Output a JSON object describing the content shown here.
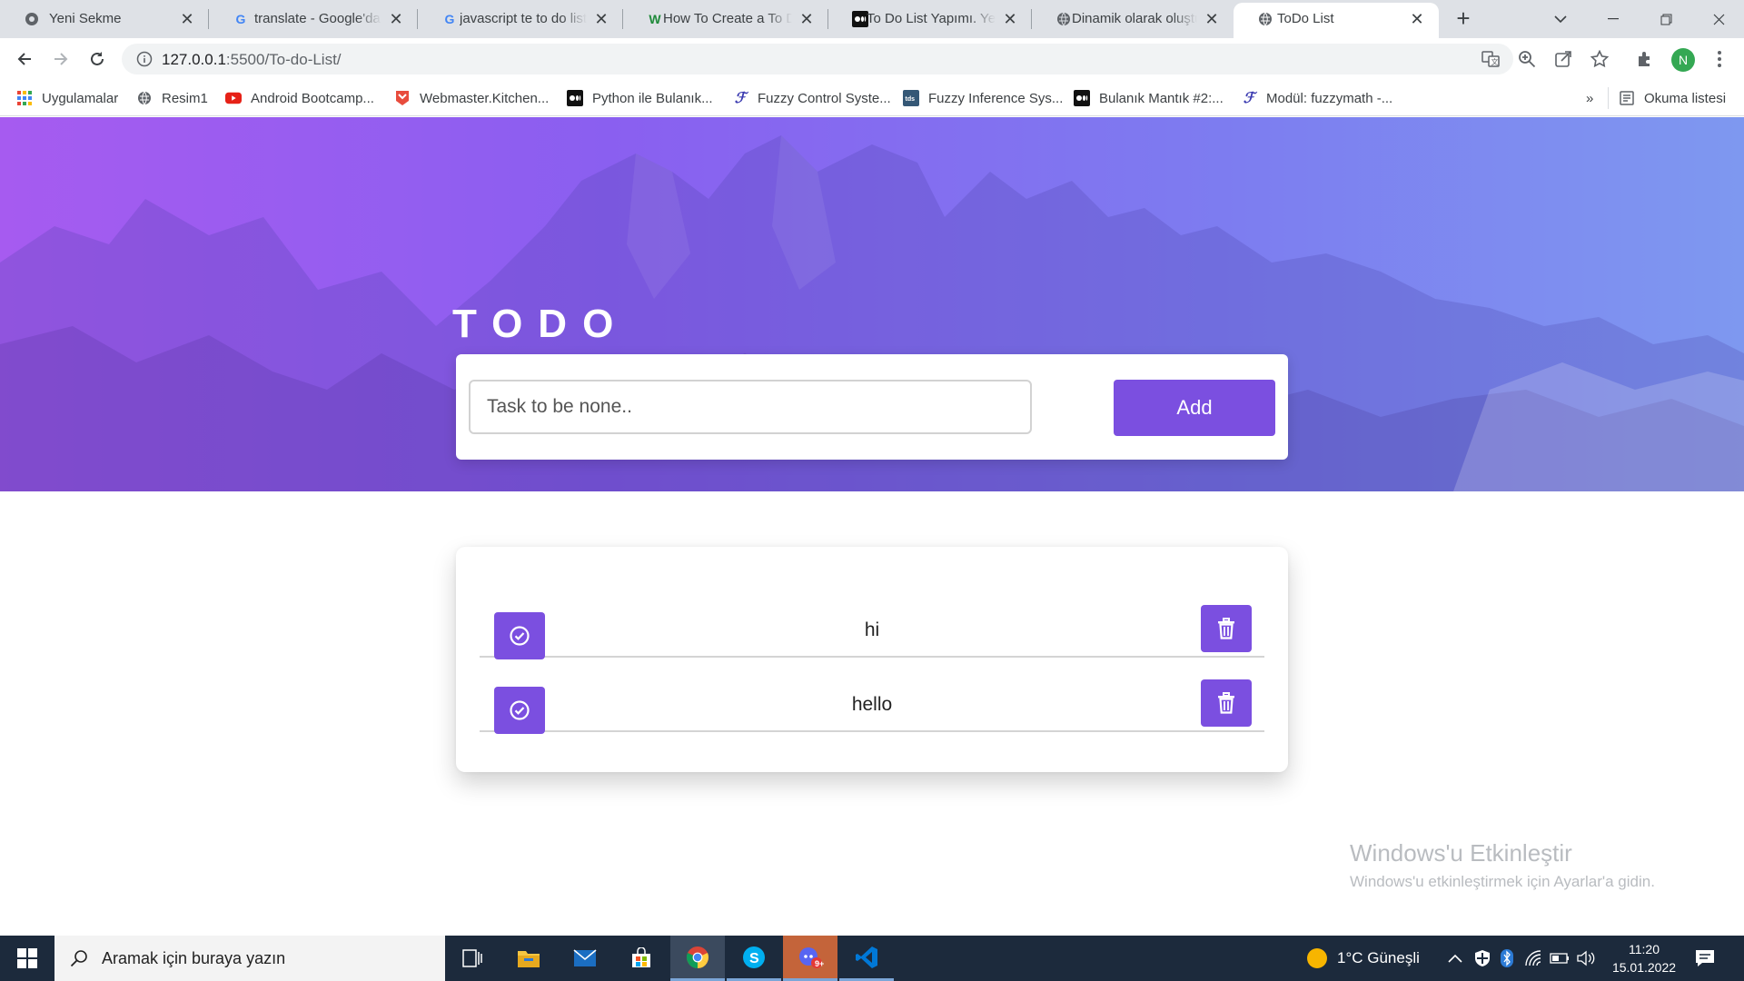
{
  "browser": {
    "tabs": [
      {
        "title": "Yeni Sekme",
        "icon": "chrome-icon"
      },
      {
        "title": "translate - Google'da Ara",
        "icon": "google-icon"
      },
      {
        "title": "javascript te to do list",
        "icon": "google-icon"
      },
      {
        "title": "How To Create a To Do List",
        "icon": "wikihow-icon"
      },
      {
        "title": "To Do List Yapımı. Yeni",
        "icon": "medium-icon"
      },
      {
        "title": "Dinamik olarak oluştur",
        "icon": "globe-icon"
      },
      {
        "title": "ToDo List",
        "icon": "globe-icon"
      }
    ],
    "url_host": "127.0.0.1",
    "url_path": ":5500/To-do-List/",
    "profile_initial": "N",
    "bookmarks": [
      {
        "label": "Uygulamalar",
        "icon": "apps-grid-icon"
      },
      {
        "label": "Resim1",
        "icon": "globe-icon"
      },
      {
        "label": "Android Bootcamp...",
        "icon": "youtube-icon"
      },
      {
        "label": "Webmaster.Kitchen...",
        "icon": "webmaster-icon"
      },
      {
        "label": "Python ile Bulanık...",
        "icon": "medium-icon"
      },
      {
        "label": "Fuzzy Control Syste...",
        "icon": "fuzzy-icon"
      },
      {
        "label": "Fuzzy Inference Sys...",
        "icon": "tds-icon"
      },
      {
        "label": "Bulanık Mantık #2:...",
        "icon": "medium-icon"
      },
      {
        "label": "Modül: fuzzymath -...",
        "icon": "fuzzy-icon"
      }
    ],
    "more_bookmarks": "»",
    "reading_list": "Okuma listesi"
  },
  "page": {
    "title": "TODO",
    "input_placeholder": "Task to be none..",
    "add_label": "Add",
    "todos": [
      {
        "text": "hi"
      },
      {
        "text": "hello"
      }
    ],
    "accent_color": "#7b4fe0"
  },
  "watermark": {
    "line1": "Windows'u Etkinleştir",
    "line2": "Windows'u etkinleştirmek için Ayarlar'a gidin."
  },
  "taskbar": {
    "search_placeholder": "Aramak için buraya yazın",
    "weather": "1°C  Güneşli",
    "time": "11:20",
    "date": "15.01.2022",
    "notification_count": "9+"
  }
}
